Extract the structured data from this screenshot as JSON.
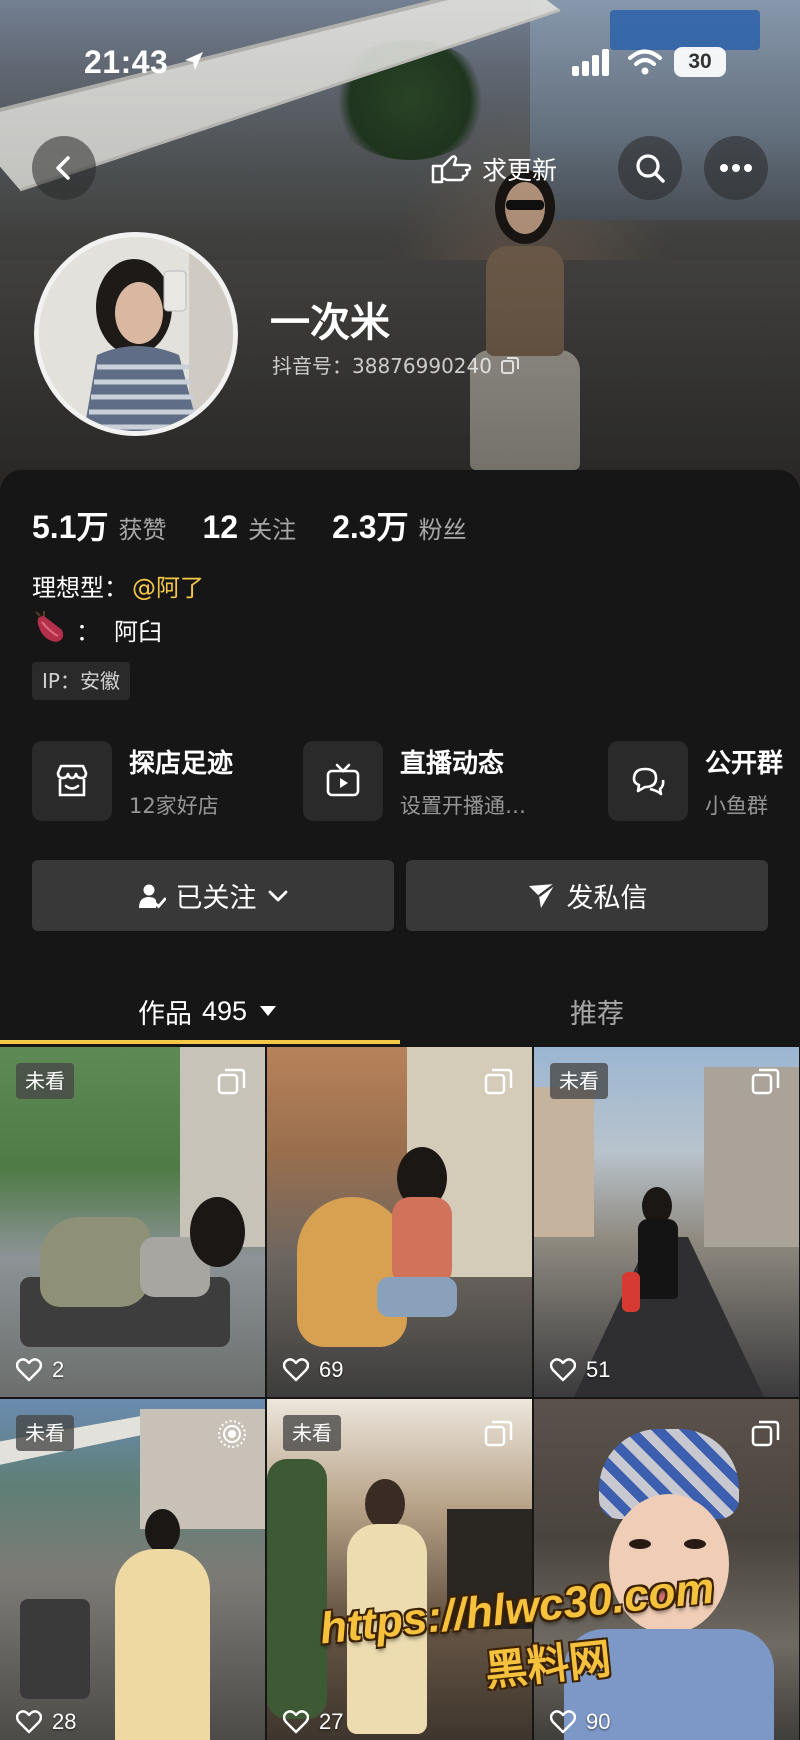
{
  "status_bar": {
    "time": "21:43",
    "battery": "30"
  },
  "nav": {
    "update_label": "求更新"
  },
  "profile": {
    "nickname": "一次米",
    "douyin_id": "抖音号：38876990240"
  },
  "stats": [
    {
      "value": "5.1万",
      "label": "获赞"
    },
    {
      "value": "12",
      "label": "关注"
    },
    {
      "value": "2.3万",
      "label": "粉丝"
    }
  ],
  "bio": {
    "line1_prefix": "理想型：",
    "line1_mention": "@阿了",
    "line2_sep": "：",
    "line2_text": "阿臼",
    "ip": "IP：安徽"
  },
  "features": [
    {
      "title": "探店足迹",
      "subtitle": "12家好店",
      "icon": "storefront-icon"
    },
    {
      "title": "直播动态",
      "subtitle": "设置开播通…",
      "icon": "tv-icon"
    },
    {
      "title": "公开群",
      "subtitle": "小鱼群",
      "icon": "chat-bubbles-icon"
    }
  ],
  "actions": {
    "follow_label": "已关注",
    "message_label": "发私信"
  },
  "tabs": {
    "works_label": "作品",
    "works_count": "495",
    "recommend_label": "推荐"
  },
  "unseen_label": "未看",
  "grid": [
    {
      "likes": "2",
      "unseen": true,
      "corner": "multi-image-icon"
    },
    {
      "likes": "69",
      "unseen": false,
      "corner": "multi-image-icon"
    },
    {
      "likes": "51",
      "unseen": true,
      "corner": "multi-image-icon"
    },
    {
      "likes": "28",
      "unseen": true,
      "corner": "live-photo-icon"
    },
    {
      "likes": "27",
      "unseen": true,
      "corner": "multi-image-icon"
    },
    {
      "likes": "90",
      "unseen": false,
      "corner": "multi-image-icon"
    }
  ],
  "watermark": {
    "url": "https://hlwc30.com",
    "name": "黑料网"
  },
  "colors": {
    "accent": "#f5c84a",
    "panel": "#161616",
    "button": "#383838"
  }
}
